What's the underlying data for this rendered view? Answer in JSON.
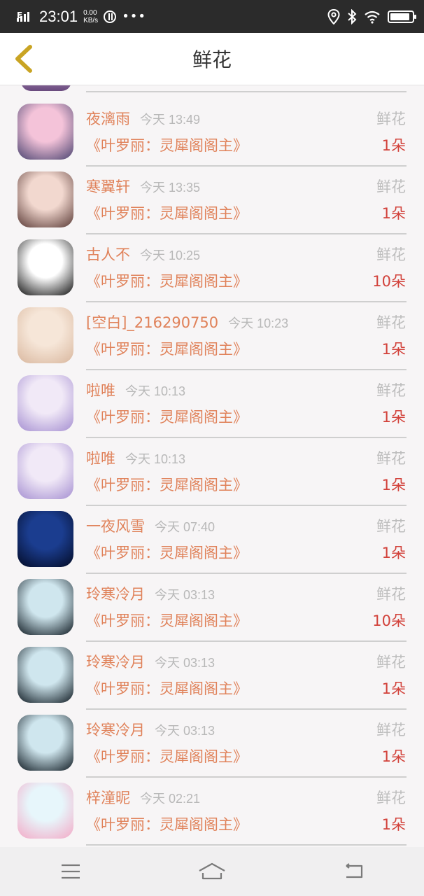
{
  "status_bar": {
    "network": "E",
    "time": "23:01",
    "speed_value": "0.00",
    "speed_unit": "KB/s",
    "battery_level": 0.9
  },
  "header": {
    "title": "鲜花",
    "back_icon": "chevron-left-icon"
  },
  "records": [
    {
      "user": "夜漓雨",
      "time": "今天 13:49",
      "gift": "鲜花",
      "book": "《叶罗丽：灵犀阁阁主》",
      "count": "1朵",
      "avatar_colors": [
        "#f4c3d9",
        "#4a4370"
      ]
    },
    {
      "user": "寒翼轩",
      "time": "今天 13:35",
      "gift": "鲜花",
      "book": "《叶罗丽：灵犀阁阁主》",
      "count": "1朵",
      "avatar_colors": [
        "#f2d8cf",
        "#5a3a36"
      ]
    },
    {
      "user": "古人不",
      "time": "今天 10:25",
      "gift": "鲜花",
      "book": "《叶罗丽：灵犀阁阁主》",
      "count": "10朵",
      "avatar_colors": [
        "#ffffff",
        "#111111"
      ]
    },
    {
      "user": "[空白]_216290750",
      "time": "今天 10:23",
      "gift": "鲜花",
      "book": "《叶罗丽：灵犀阁阁主》",
      "count": "1朵",
      "avatar_colors": [
        "#f6e6d8",
        "#d9b79e"
      ]
    },
    {
      "user": "啦唯",
      "time": "今天 10:13",
      "gift": "鲜花",
      "book": "《叶罗丽：灵犀阁阁主》",
      "count": "1朵",
      "avatar_colors": [
        "#f1e9f7",
        "#a58fd1"
      ]
    },
    {
      "user": "啦唯",
      "time": "今天 10:13",
      "gift": "鲜花",
      "book": "《叶罗丽：灵犀阁阁主》",
      "count": "1朵",
      "avatar_colors": [
        "#f1e9f7",
        "#a58fd1"
      ]
    },
    {
      "user": "一夜风雪",
      "time": "今天 07:40",
      "gift": "鲜花",
      "book": "《叶罗丽：灵犀阁阁主》",
      "count": "1朵",
      "avatar_colors": [
        "#1b3d8f",
        "#030b25"
      ]
    },
    {
      "user": "玲寒冷月",
      "time": "今天 03:13",
      "gift": "鲜花",
      "book": "《叶罗丽：灵犀阁阁主》",
      "count": "10朵",
      "avatar_colors": [
        "#cfe6ee",
        "#0f1a22"
      ]
    },
    {
      "user": "玲寒冷月",
      "time": "今天 03:13",
      "gift": "鲜花",
      "book": "《叶罗丽：灵犀阁阁主》",
      "count": "1朵",
      "avatar_colors": [
        "#cfe6ee",
        "#0f1a22"
      ]
    },
    {
      "user": "玲寒冷月",
      "time": "今天 03:13",
      "gift": "鲜花",
      "book": "《叶罗丽：灵犀阁阁主》",
      "count": "1朵",
      "avatar_colors": [
        "#cfe6ee",
        "#0f1a22"
      ]
    },
    {
      "user": "梓潼昵",
      "time": "今天 02:21",
      "gift": "鲜花",
      "book": "《叶罗丽：灵犀阁阁主》",
      "count": "1朵",
      "avatar_colors": [
        "#e7f6fb",
        "#f3a9c6"
      ]
    }
  ],
  "nav_bar": {
    "menu_icon": "menu-icon",
    "home_icon": "home-icon",
    "back_icon": "back-icon"
  }
}
